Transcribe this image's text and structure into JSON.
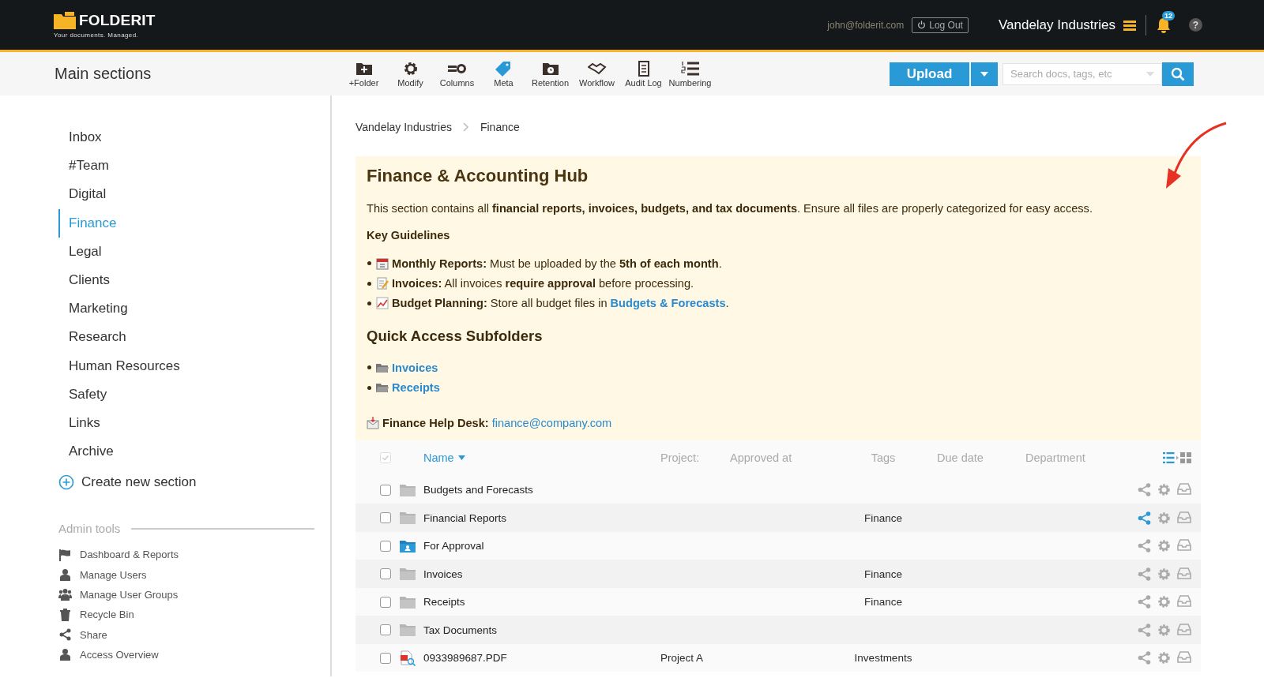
{
  "header": {
    "logo": "FOLDERIT",
    "tagline": "Your documents. Managed.",
    "user_email": "john@folderit.com",
    "logout": "Log Out",
    "company": "Vandelay Industries",
    "notifications": "12",
    "help": "?"
  },
  "toolbar": {
    "title": "Main sections",
    "tools": [
      "+Folder",
      "Modify",
      "Columns",
      "Meta",
      "Retention",
      "Workflow",
      "Audit Log",
      "Numbering"
    ],
    "upload": "Upload",
    "search": {
      "placeholder": "Search docs, tags, etc"
    }
  },
  "sidebar": {
    "sections": [
      {
        "label": "Inbox",
        "selected": false
      },
      {
        "label": "#Team",
        "selected": false
      },
      {
        "label": "Digital",
        "selected": false
      },
      {
        "label": "Finance",
        "selected": true
      },
      {
        "label": "Legal",
        "selected": false
      },
      {
        "label": "Clients",
        "selected": false
      },
      {
        "label": "Marketing",
        "selected": false
      },
      {
        "label": "Research",
        "selected": false
      },
      {
        "label": "Human Resources",
        "selected": false
      },
      {
        "label": "Safety",
        "selected": false
      },
      {
        "label": "Links",
        "selected": false
      },
      {
        "label": "Archive",
        "selected": false
      }
    ],
    "create": "Create new section",
    "admin": {
      "title": "Admin tools",
      "items": [
        "Dashboard & Reports",
        "Manage Users",
        "Manage User Groups",
        "Recycle Bin",
        "Share",
        "Access Overview"
      ]
    }
  },
  "breadcrumb": [
    "Vandelay Industries",
    "Finance"
  ],
  "hub": {
    "title": "Finance & Accounting Hub",
    "intro": "This section contains all **financial reports, invoices, budgets, and tax documents**. Ensure all files are properly categorized for easy access.",
    "guidelines_title": "Key Guidelines",
    "guidelines": [
      {
        "text": "**Monthly Reports:** Must be uploaded by the **5th of each month**."
      },
      {
        "text": "**Invoices:** All invoices **require approval** before processing."
      },
      {
        "text": "**Budget Planning:** Store all budget files in",
        "link": "Budgets & Forecasts",
        "after": "."
      }
    ],
    "subfolders_title": "Quick Access Subfolders",
    "subfolders": [
      "Invoices",
      "Receipts"
    ],
    "help_label": "Finance Help Desk:",
    "help_email": "finance@company.com"
  },
  "table": {
    "select_all": {
      "disabled": true
    },
    "columns": [
      "Name",
      "Project:",
      "Approved at",
      "Tags",
      "Due date",
      "Department"
    ],
    "rows": [
      {
        "kind": "folder",
        "name": "Budgets and Forecasts",
        "checked": false,
        "shared": false
      },
      {
        "kind": "folder",
        "name": "Financial Reports",
        "tags": "Finance",
        "checked": false,
        "shared": true
      },
      {
        "kind": "approval",
        "name": "For Approval",
        "checked": false,
        "shared": false
      },
      {
        "kind": "folder",
        "name": "Invoices",
        "tags": "Finance",
        "checked": false,
        "shared": false
      },
      {
        "kind": "folder",
        "name": "Receipts",
        "tags": "Finance",
        "checked": false,
        "shared": false
      },
      {
        "kind": "folder",
        "name": "Tax Documents",
        "checked": false,
        "shared": false
      },
      {
        "kind": "pdf",
        "name": "0933989687.PDF",
        "project": "Project A",
        "tags": "Investments",
        "checked": false,
        "shared": false
      }
    ]
  }
}
